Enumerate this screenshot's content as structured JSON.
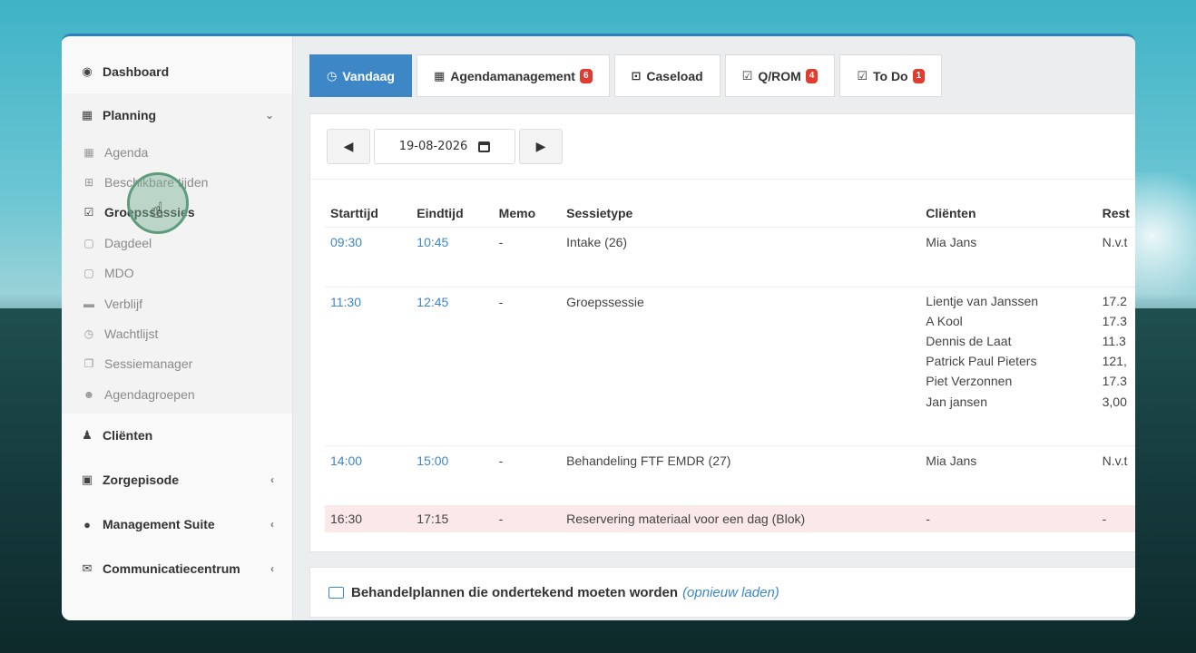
{
  "sidebar": {
    "items": [
      {
        "label": "Dashboard",
        "icon": "dashboard-icon"
      },
      {
        "label": "Planning",
        "icon": "calendar-icon"
      },
      {
        "label": "Cliënten",
        "icon": "user-icon"
      },
      {
        "label": "Zorgepisode",
        "icon": "briefcase-icon"
      },
      {
        "label": "Management Suite",
        "icon": "globe-icon"
      },
      {
        "label": "Communicatiecentrum",
        "icon": "envelope-icon"
      }
    ],
    "planning_sub": [
      {
        "label": "Agenda"
      },
      {
        "label": "Beschikbare tijden"
      },
      {
        "label": "Groepssessies"
      },
      {
        "label": "Dagdeel"
      },
      {
        "label": "MDO"
      },
      {
        "label": "Verblijf"
      },
      {
        "label": "Wachtlijst"
      },
      {
        "label": "Sessiemanager"
      },
      {
        "label": "Agendagroepen"
      }
    ]
  },
  "tabs": [
    {
      "label": "Vandaag"
    },
    {
      "label": "Agendamanagement",
      "badge": "6"
    },
    {
      "label": "Caseload"
    },
    {
      "label": "Q/ROM",
      "badge": "4"
    },
    {
      "label": "To Do",
      "badge": "1"
    }
  ],
  "datebar": {
    "date": "19-08-2026"
  },
  "table": {
    "headers": [
      "Starttijd",
      "Eindtijd",
      "Memo",
      "Sessietype",
      "Cliënten",
      "Rest"
    ],
    "rows": [
      {
        "start": "09:30",
        "end": "10:45",
        "memo": "-",
        "type": "Intake (26)",
        "clients": [
          "Mia Jans"
        ],
        "rest": [
          "N.v.t"
        ]
      },
      {
        "start": "11:30",
        "end": "12:45",
        "memo": "-",
        "type": "Groepssessie",
        "clients": [
          "Lientje van Janssen",
          "A Kool",
          "Dennis de Laat",
          "Patrick Paul Pieters",
          "Piet Verzonnen",
          "Jan jansen"
        ],
        "rest": [
          "17.2",
          "17.3",
          "11.3",
          "121,",
          "17.3",
          "3,00"
        ]
      },
      {
        "start": "14:00",
        "end": "15:00",
        "memo": "-",
        "type": "Behandeling FTF EMDR (27)",
        "clients": [
          "Mia Jans"
        ],
        "rest": [
          "N.v.t"
        ]
      },
      {
        "start": "16:30",
        "end": "17:15",
        "memo": "-",
        "type": "Reservering materiaal voor een dag (Blok)",
        "clients": [
          "-"
        ],
        "rest": [
          "-"
        ]
      }
    ]
  },
  "bottom_panel": {
    "title": "Behandelplannen die ondertekend moeten worden",
    "reload": "(opnieuw laden)"
  }
}
